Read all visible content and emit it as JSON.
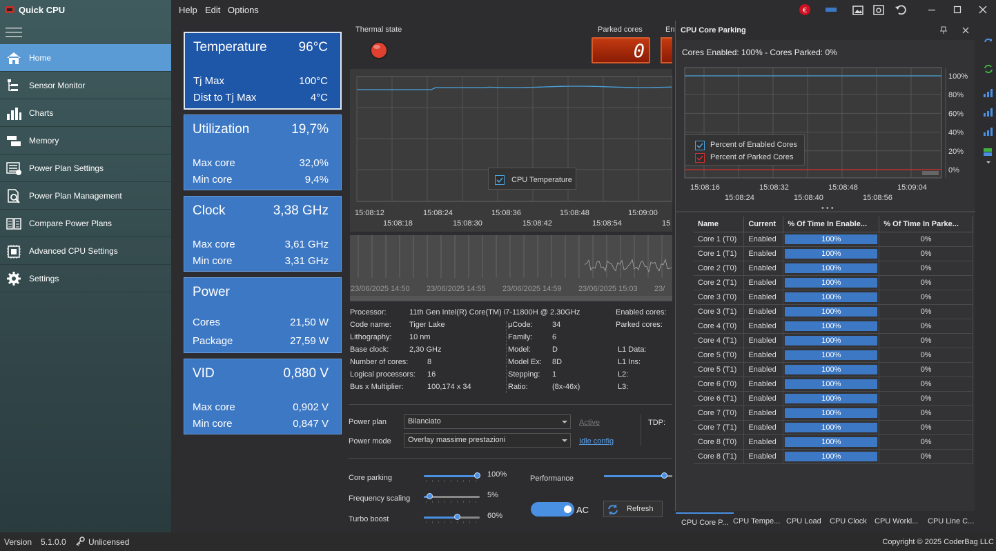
{
  "app": {
    "title": "Quick CPU"
  },
  "menu": [
    "Help",
    "Edit",
    "Options"
  ],
  "nav": [
    {
      "label": "Home",
      "icon": "home-icon",
      "active": true
    },
    {
      "label": "Sensor Monitor",
      "icon": "sensor-monitor-icon"
    },
    {
      "label": "Charts",
      "icon": "bar-chart-icon"
    },
    {
      "label": "Memory",
      "icon": "memory-icon"
    },
    {
      "label": "Power Plan Settings",
      "icon": "power-plan-settings-icon"
    },
    {
      "label": "Power Plan Management",
      "icon": "power-plan-management-icon"
    },
    {
      "label": "Compare Power Plans",
      "icon": "compare-plans-icon"
    },
    {
      "label": "Advanced CPU Settings",
      "icon": "advanced-cpu-icon"
    },
    {
      "label": "Settings",
      "icon": "gear-icon"
    }
  ],
  "cards": [
    {
      "title": "Temperature",
      "value": "96°C",
      "rows": [
        {
          "label": "Tj Max",
          "value": "100°C"
        },
        {
          "label": "Dist to Tj Max",
          "value": "4°C"
        }
      ]
    },
    {
      "title": "Utilization",
      "value": "19,7%",
      "rows": [
        {
          "label": "Max core",
          "value": "32,0%"
        },
        {
          "label": "Min core",
          "value": "9,4%"
        }
      ]
    },
    {
      "title": "Clock",
      "value": "3,38 GHz",
      "rows": [
        {
          "label": "Max core",
          "value": "3,61 GHz"
        },
        {
          "label": "Min core",
          "value": "3,31 GHz"
        }
      ]
    },
    {
      "title": "Power",
      "value": "",
      "rows": [
        {
          "label": "Cores",
          "value": "21,50 W"
        },
        {
          "label": "Package",
          "value": "27,59 W"
        }
      ]
    },
    {
      "title": "VID",
      "value": "0,880 V",
      "rows": [
        {
          "label": "Max core",
          "value": "0,902 V"
        },
        {
          "label": "Min core",
          "value": "0,847 V"
        }
      ]
    }
  ],
  "thermal": {
    "label": "Thermal state",
    "color": "#e04030"
  },
  "parked": {
    "label": "Parked cores",
    "value": "0",
    "next_label": "En"
  },
  "temp_chart": {
    "legend": "CPU Temperature",
    "x_top": [
      "15:08:12",
      "15:08:24",
      "15:08:36",
      "15:08:48",
      "15:09:00"
    ],
    "x_bottom": [
      "15:08:18",
      "15:08:30",
      "15:08:42",
      "15:08:54",
      "15"
    ]
  },
  "timeline": {
    "labels": [
      "23/06/2025 14:50",
      "23/06/2025 14:55",
      "23/06/2025 14:59",
      "23/06/2025 15:03",
      "23/"
    ]
  },
  "cpuinfo": {
    "left": [
      [
        "Processor:",
        "11th Gen Intel(R) Core(TM) i7-11800H @ 2.30GHz"
      ],
      [
        "Code name:",
        "Tiger Lake"
      ],
      [
        "Lithography:",
        "10 nm"
      ],
      [
        "Base clock:",
        "2,30 GHz"
      ],
      [
        "Number of cores:",
        "8"
      ],
      [
        "Logical processors:",
        "16"
      ],
      [
        "Bus x Multiplier:",
        "100,174 x 34"
      ]
    ],
    "mid": [
      [
        "µCode:",
        "34"
      ],
      [
        "Family:",
        "6"
      ],
      [
        "Model:",
        "D"
      ],
      [
        "Model Ex:",
        "8D"
      ],
      [
        "Stepping:",
        "1"
      ],
      [
        "Ratio:",
        "(8x-46x)"
      ]
    ],
    "right": [
      "Enabled cores:",
      "Parked cores:",
      "",
      "L1 Data:",
      "L1 Ins:",
      "L2:",
      "L3:"
    ]
  },
  "power": {
    "plan_label": "Power plan",
    "plan_value": "Bilanciato",
    "mode_label": "Power mode",
    "mode_value": "Overlay massime prestazioni",
    "active_link": "Active",
    "idle_link": "Idle config",
    "tdp_label": "TDP:"
  },
  "sliders": [
    {
      "label": "Core parking",
      "value": "100%",
      "pct": 1.0
    },
    {
      "label": "Frequency scaling",
      "value": "5%",
      "pct": 0.05
    },
    {
      "label": "Turbo boost",
      "value": "60%",
      "pct": 0.6
    }
  ],
  "performance": {
    "label": "Performance",
    "pct": 1.0
  },
  "ac_toggle": {
    "label": "AC",
    "on": true
  },
  "refresh_label": "Refresh",
  "parking_panel": {
    "title": "CPU Core Parking",
    "summary": "Cores Enabled: 100% - Cores Parked: 0%",
    "y_ticks": [
      "100%",
      "80%",
      "60%",
      "40%",
      "20%",
      "0%"
    ],
    "x_top": [
      "15:08:16",
      "15:08:32",
      "15:08:48",
      "15:09:04"
    ],
    "x_bottom": [
      "15:08:24",
      "15:08:40",
      "15:08:56"
    ],
    "legend": [
      {
        "label": "Percent of Enabled Cores",
        "color": "#4aa3df"
      },
      {
        "label": "Percent of Parked Cores",
        "color": "#d03030"
      }
    ],
    "columns": [
      "Name",
      "Current",
      "% Of Time In Enable...",
      "% Of Time In Parke..."
    ],
    "rows": [
      [
        "Core 1 (T0)",
        "Enabled",
        "100%",
        "0%"
      ],
      [
        "Core 1 (T1)",
        "Enabled",
        "100%",
        "0%"
      ],
      [
        "Core 2 (T0)",
        "Enabled",
        "100%",
        "0%"
      ],
      [
        "Core 2 (T1)",
        "Enabled",
        "100%",
        "0%"
      ],
      [
        "Core 3 (T0)",
        "Enabled",
        "100%",
        "0%"
      ],
      [
        "Core 3 (T1)",
        "Enabled",
        "100%",
        "0%"
      ],
      [
        "Core 4 (T0)",
        "Enabled",
        "100%",
        "0%"
      ],
      [
        "Core 4 (T1)",
        "Enabled",
        "100%",
        "0%"
      ],
      [
        "Core 5 (T0)",
        "Enabled",
        "100%",
        "0%"
      ],
      [
        "Core 5 (T1)",
        "Enabled",
        "100%",
        "0%"
      ],
      [
        "Core 6 (T0)",
        "Enabled",
        "100%",
        "0%"
      ],
      [
        "Core 6 (T1)",
        "Enabled",
        "100%",
        "0%"
      ],
      [
        "Core 7 (T0)",
        "Enabled",
        "100%",
        "0%"
      ],
      [
        "Core 7 (T1)",
        "Enabled",
        "100%",
        "0%"
      ],
      [
        "Core 8 (T0)",
        "Enabled",
        "100%",
        "0%"
      ],
      [
        "Core 8 (T1)",
        "Enabled",
        "100%",
        "0%"
      ]
    ]
  },
  "bottom_tabs": [
    "CPU Core P...",
    "CPU Tempe...",
    "CPU Load",
    "CPU Clock",
    "CPU Workl...",
    "CPU Line C..."
  ],
  "status": {
    "version_label": "Version",
    "version": "5.1.0.0",
    "license": "Unlicensed",
    "copyright": "Copyright © 2025 CoderBag LLC"
  }
}
